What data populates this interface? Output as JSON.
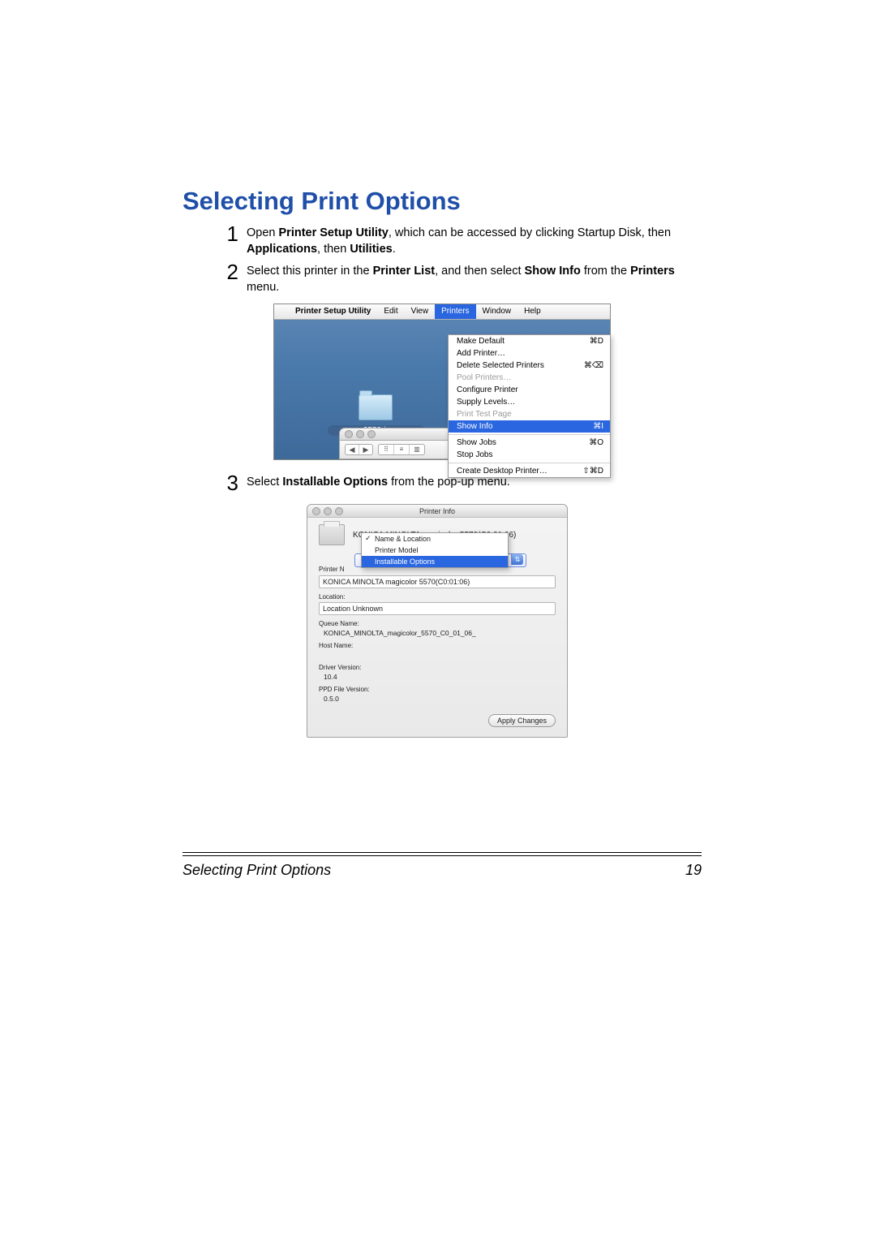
{
  "heading": "Selecting Print Options",
  "steps": {
    "s1": {
      "num": "1",
      "p1a": "Open ",
      "p1b": "Printer Setup Utility",
      "p1c": ", which can be accessed by clicking Startup Disk, then ",
      "p1d": "Applications",
      "p1e": ", then ",
      "p1f": "Utilities",
      "p1g": "."
    },
    "s2": {
      "num": "2",
      "p2a": "Select this printer in the ",
      "p2b": "Printer List",
      "p2c": ", and then select ",
      "p2d": "Show Info",
      "p2e": " from the ",
      "p2f": "Printers",
      "p2g": " menu."
    },
    "s3": {
      "num": "3",
      "p3a": "Select ",
      "p3b": "Installable Options",
      "p3c": " from the pop-up menu."
    }
  },
  "menubar": {
    "app": "Printer Setup Utility",
    "items": [
      "Edit",
      "View",
      "Printers",
      "Window",
      "Help"
    ]
  },
  "desktop": {
    "folder_label": "mc2550-ja-rg"
  },
  "dropdown": {
    "i0": {
      "label": "Make Default",
      "short": "⌘D"
    },
    "i1": {
      "label": "Add Printer…",
      "short": ""
    },
    "i2": {
      "label": "Delete Selected Printers",
      "short": "⌘⌫"
    },
    "i3": {
      "label": "Pool Printers…",
      "short": ""
    },
    "i4": {
      "label": "Configure Printer",
      "short": ""
    },
    "i5": {
      "label": "Supply Levels…",
      "short": ""
    },
    "i6": {
      "label": "Print Test Page",
      "short": ""
    },
    "i7": {
      "label": "Show Info",
      "short": "⌘I"
    },
    "i8": {
      "label": "Show Jobs",
      "short": "⌘O"
    },
    "i9": {
      "label": "Stop Jobs",
      "short": ""
    },
    "i10": {
      "label": "Create Desktop Printer…",
      "short": "⇧⌘D"
    }
  },
  "printer_info": {
    "title": "Printer Info",
    "printer": "KONICA MINOLTA magicolor 5570(C0:01:06)",
    "popup": {
      "o0": "Name & Location",
      "o1": "Printer Model",
      "o2": "Installable Options",
      "side_label": "Printer N"
    },
    "fields": {
      "name_val": "KONICA MINOLTA magicolor 5570(C0:01:06)",
      "location_label": "Location:",
      "location_val": "Location Unknown",
      "queue_label": "Queue Name:",
      "queue_val": "KONICA_MINOLTA_magicolor_5570_C0_01_06_",
      "host_label": "Host Name:",
      "driver_label": "Driver Version:",
      "driver_val": "10.4",
      "ppd_label": "PPD File Version:",
      "ppd_val": "0.5.0"
    },
    "apply": "Apply Changes"
  },
  "footer": {
    "left": "Selecting Print Options",
    "right": "19"
  }
}
